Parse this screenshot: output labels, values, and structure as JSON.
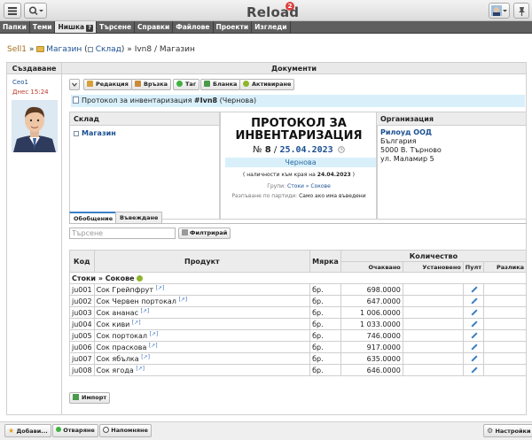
{
  "app": {
    "title": "Reload",
    "notifications": "2"
  },
  "nav": [
    {
      "label": "Папки"
    },
    {
      "label": "Теми"
    },
    {
      "label": "Нишка",
      "badge": "?"
    },
    {
      "label": "Търсене"
    },
    {
      "label": "Справки"
    },
    {
      "label": "Файлове"
    },
    {
      "label": "Проекти"
    },
    {
      "label": "Изгледи"
    }
  ],
  "breadcrumb": {
    "root": "Sell1",
    "folder": "Магазин",
    "open_paren": "(",
    "store": "Склад",
    "close_paren": ")",
    "sep": "»",
    "doc": "Ivn8 / Магазин"
  },
  "columns": {
    "created": "Създаване",
    "documents": "Документи"
  },
  "author": {
    "name": "Ceo1",
    "date": "Днес 15:24"
  },
  "actions": {
    "edit": "Редакция",
    "link": "Връзка",
    "tag": "Таг",
    "blank": "Бланка",
    "activate": "Активиране"
  },
  "protocol_bar": {
    "prefix": "Протокол за инвентаризация",
    "number": "#Ivn8",
    "status": "(Чернова)"
  },
  "store": {
    "title": "Склад",
    "name": "Магазин"
  },
  "document": {
    "title_line1": "ПРОТОКОЛ ЗА",
    "title_line2": "ИНВЕНТАРИЗАЦИЯ",
    "num_label": "№",
    "number": "8",
    "slash": "/",
    "date": "25.04.2023",
    "status": "Чернова",
    "qty_note_prefix": "( наличности към края на",
    "qty_note_date": "24.04.2023",
    "qty_note_suffix": ")",
    "groups_label": "Групи:",
    "groups_value": "Стоки » Сокове",
    "sort_label": "Разпъване по партиди:",
    "sort_value": "Само ако има въведени"
  },
  "organization": {
    "title": "Организация",
    "name": "Рилоуд ООД",
    "country": "България",
    "city": "5000 В. Търново",
    "street": "ул. Маламир 5"
  },
  "tabs": {
    "summary": "Обобщение",
    "entry": "Въвеждане"
  },
  "search": {
    "placeholder": "Търсене"
  },
  "filter_label": "Филтрирай",
  "table": {
    "headers": {
      "code": "Код",
      "product": "Продукт",
      "unit": "Мярка",
      "quantity": "Количество",
      "expected": "Очаквано",
      "entered": "Установено",
      "pult": "Пулт",
      "diff": "Разлика"
    },
    "group": "Стоки » Сокове",
    "rows": [
      {
        "code": "ju001",
        "name": "Сок Грейпфрут",
        "unit": "бр.",
        "expected": "698.0000"
      },
      {
        "code": "ju002",
        "name": "Сок Червен портокал",
        "unit": "бр.",
        "expected": "647.0000"
      },
      {
        "code": "ju003",
        "name": "Сок ананас",
        "unit": "бр.",
        "expected": "1 006.0000"
      },
      {
        "code": "ju004",
        "name": "Сок киви",
        "unit": "бр.",
        "expected": "1 033.0000"
      },
      {
        "code": "ju005",
        "name": "Сок портокал",
        "unit": "бр.",
        "expected": "746.0000"
      },
      {
        "code": "ju006",
        "name": "Сок праскова",
        "unit": "бр.",
        "expected": "917.0000"
      },
      {
        "code": "ju007",
        "name": "Сок ябълка",
        "unit": "бр.",
        "expected": "635.0000"
      },
      {
        "code": "ju008",
        "name": "Сок ягода",
        "unit": "бр.",
        "expected": "646.0000"
      }
    ]
  },
  "import_label": "Импорт",
  "bottom": {
    "add": "Добави...",
    "open": "Отваряне",
    "remind": "Напомняне",
    "settings": "Настройки"
  },
  "colors": {
    "link": "#1a4f93",
    "accent": "#3a80c9",
    "highlight": "#d9f0fb",
    "nav": "#5f5f5f",
    "alert": "#c0392b"
  }
}
